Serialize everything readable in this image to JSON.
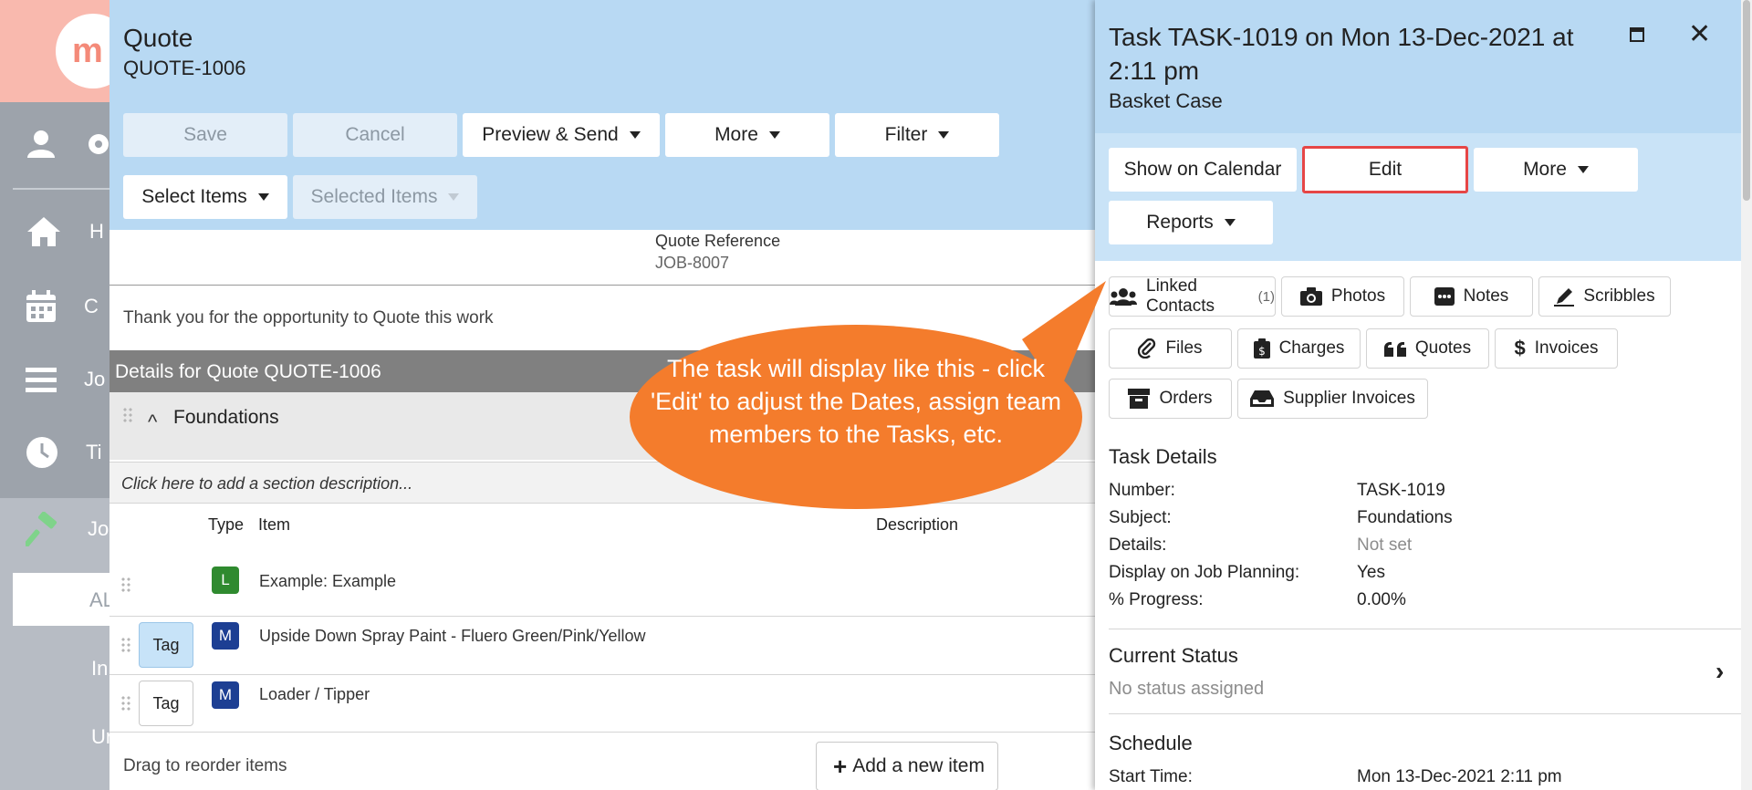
{
  "sidebar": {
    "logo_text": "m",
    "nav_letters": [
      "H",
      "C",
      "Jo",
      "Ti",
      "Jo"
    ],
    "active_item": "AL",
    "sub_items": [
      "In",
      "Ur"
    ]
  },
  "quote": {
    "title": "Quote",
    "number": "QUOTE-1006",
    "toolbar": {
      "save": "Save",
      "cancel": "Cancel",
      "preview_send": "Preview & Send",
      "more": "More",
      "filter": "Filter",
      "select_items": "Select Items",
      "selected_items": "Selected Items"
    },
    "reference_label": "Quote Reference",
    "reference_value": "JOB-8007",
    "intro": "Thank you for the opportunity to Quote this work",
    "details_header": "Details for Quote QUOTE-1006",
    "section_name": "Foundations",
    "section_desc_placeholder": "Click here to add a section description...",
    "columns": {
      "type": "Type",
      "item": "Item",
      "description": "Description"
    },
    "rows": [
      {
        "type": "L",
        "name": "Example: Example",
        "tag": ""
      },
      {
        "type": "M",
        "name": "Upside Down Spray Paint - Fluero Green/Pink/Yellow",
        "tag": "Tag"
      },
      {
        "type": "M",
        "name": "Loader / Tipper",
        "tag": "Tag"
      }
    ],
    "drag_note": "Drag to reorder items",
    "add_item": "Add a new item"
  },
  "task": {
    "title": "Task TASK-1019 on Mon 13-Dec-2021 at 2:11 pm",
    "subtitle": "Basket Case",
    "toolbar": {
      "show_on_calendar": "Show on Calendar",
      "edit": "Edit",
      "more": "More",
      "reports": "Reports"
    },
    "sections": {
      "linked_contacts": "Linked Contacts",
      "linked_contacts_count": "(1)",
      "photos": "Photos",
      "notes": "Notes",
      "scribbles": "Scribbles",
      "files": "Files",
      "charges": "Charges",
      "quotes": "Quotes",
      "invoices": "Invoices",
      "orders": "Orders",
      "supplier_invoices": "Supplier Invoices"
    },
    "details_title": "Task Details",
    "details": {
      "number_label": "Number:",
      "number": "TASK-1019",
      "subject_label": "Subject:",
      "subject": "Foundations",
      "details_label": "Details:",
      "details": "Not set",
      "display_label": "Display on Job Planning:",
      "display": "Yes",
      "progress_label": "% Progress:",
      "progress": "0.00%"
    },
    "status_title": "Current Status",
    "status_value": "No status assigned",
    "schedule_title": "Schedule",
    "start_label": "Start Time:",
    "start_value": "Mon 13-Dec-2021 2:11 pm"
  },
  "callout": {
    "text": "The task will display like this - click 'Edit' to adjust the Dates, assign team members to the Tasks, etc.",
    "color": "#f47c2c"
  }
}
